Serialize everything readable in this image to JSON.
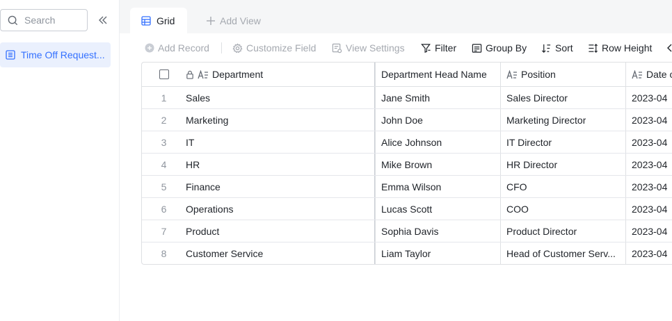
{
  "sidebar": {
    "search_placeholder": "Search",
    "items": [
      {
        "label": "Time Off Request..."
      }
    ]
  },
  "tabs": {
    "active_label": "Grid",
    "add_view_label": "Add View"
  },
  "toolbar": {
    "add_record": "Add Record",
    "customize_field": "Customize Field",
    "view_settings": "View Settings",
    "filter": "Filter",
    "group_by": "Group By",
    "sort": "Sort",
    "row_height": "Row Height"
  },
  "table": {
    "columns": [
      "Department",
      "Department Head Name",
      "Position",
      "Date o"
    ],
    "rows": [
      {
        "num": "1",
        "department": "Sales",
        "head": "Jane Smith",
        "position": "Sales Director",
        "date": "2023-04"
      },
      {
        "num": "2",
        "department": "Marketing",
        "head": "John Doe",
        "position": "Marketing Director",
        "date": "2023-04"
      },
      {
        "num": "3",
        "department": "IT",
        "head": "Alice Johnson",
        "position": "IT Director",
        "date": "2023-04"
      },
      {
        "num": "4",
        "department": "HR",
        "head": "Mike Brown",
        "position": "HR Director",
        "date": "2023-04"
      },
      {
        "num": "5",
        "department": "Finance",
        "head": "Emma Wilson",
        "position": "CFO",
        "date": "2023-04"
      },
      {
        "num": "6",
        "department": "Operations",
        "head": "Lucas Scott",
        "position": "COO",
        "date": "2023-04"
      },
      {
        "num": "7",
        "department": "Product",
        "head": "Sophia Davis",
        "position": "Product Director",
        "date": "2023-04"
      },
      {
        "num": "8",
        "department": "Customer Service",
        "head": "Liam Taylor",
        "position": "Head of Customer Serv...",
        "date": "2023-04"
      }
    ]
  },
  "colors": {
    "accent": "#3370ff",
    "selected_bg": "#eaf0fd",
    "tabbar_bg": "#f5f6f7",
    "disabled_text": "#a5a9b0"
  },
  "icons": {
    "search": "search-icon",
    "collapse": "double-chevron-left-icon",
    "table": "grid-table-icon",
    "add": "plus-icon",
    "add_record": "plus-circle-icon",
    "customize": "gear-icon",
    "view_settings": "settings-doc-icon",
    "filter": "filter-icon",
    "group_by": "group-icon",
    "sort": "sort-icon",
    "row_height": "row-height-icon",
    "lock": "lock-icon",
    "text_field": "text-field-icon"
  }
}
